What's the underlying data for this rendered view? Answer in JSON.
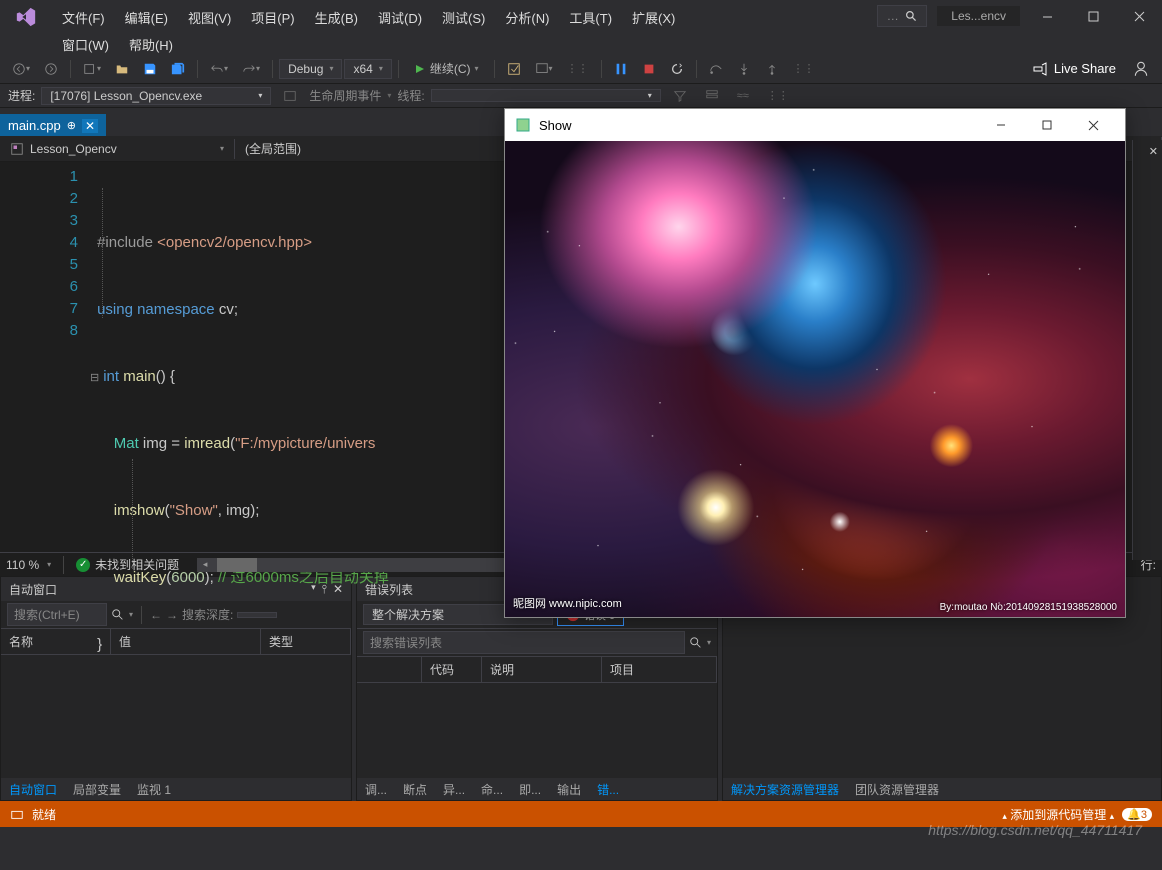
{
  "menubar": {
    "file": "文件(F)",
    "edit": "编辑(E)",
    "view": "视图(V)",
    "project": "项目(P)",
    "build": "生成(B)",
    "debug": "调试(D)",
    "test": "测试(S)",
    "analyze": "分析(N)",
    "tools": "工具(T)",
    "extensions": "扩展(X)",
    "window": "窗口(W)",
    "help": "帮助(H)"
  },
  "title_tab": "Les...encv",
  "toolbar": {
    "config": "Debug",
    "platform": "x64",
    "continue": "继续(C)",
    "live_share": "Live Share"
  },
  "debugbar": {
    "process_label": "进程:",
    "process": "[17076] Lesson_Opencv.exe",
    "lifecycle": "生命周期事件",
    "thread_label": "线程:"
  },
  "tab": {
    "name": "main.cpp"
  },
  "navbar": {
    "project": "Lesson_Opencv",
    "scope": "(全局范围)"
  },
  "code": {
    "l1": {
      "pre": "#include ",
      "inc": "<opencv2/opencv.hpp>"
    },
    "l2": {
      "kw": "using namespace ",
      "ns": "cv",
      ";": ";"
    },
    "l3": {
      "kw": "int ",
      "fn": "main",
      "rest": "() {"
    },
    "l4": {
      "cls": "Mat ",
      "id": "img ",
      "op": "= ",
      "fn": "imread",
      "p1": "(",
      "str": "\"F:/mypicture/univers",
      "rest": ""
    },
    "l5": {
      "fn": "imshow",
      "p": "(",
      "str": "\"Show\"",
      "c": ", ",
      "id": "img",
      "e": ");"
    },
    "l6": {
      "fn": "waitKey",
      "p": "(",
      "num": "6000",
      "e": "); ",
      "cm": "// 过6000ms之后自动关掉"
    },
    "l7": {
      "brace": "}"
    }
  },
  "lines": [
    "1",
    "2",
    "3",
    "4",
    "5",
    "6",
    "7",
    "8"
  ],
  "editor_footer": {
    "zoom": "110 %",
    "issues": "未找到相关问题",
    "line_label": "行:"
  },
  "auto_panel": {
    "title": "自动窗口",
    "search_ph": "搜索(Ctrl+E)",
    "depth_label": "搜索深度:",
    "cols": {
      "name": "名称",
      "value": "值",
      "type": "类型"
    }
  },
  "error_panel": {
    "title": "错误列表",
    "solution": "整个解决方案",
    "errors": "错误 0",
    "search_ph": "搜索错误列表",
    "cols": {
      "code": "代码",
      "desc": "说明",
      "project": "项目"
    }
  },
  "bottom_tabs_left": {
    "auto": "自动窗口",
    "locals": "局部变量",
    "watch": "监视 1"
  },
  "bottom_tabs_mid": {
    "a": "调...",
    "b": "断点",
    "c": "异...",
    "d": "命...",
    "e": "即...",
    "f": "输出",
    "g": "错..."
  },
  "bottom_tabs_right": {
    "a": "解决方案资源管理器",
    "b": "团队资源管理器"
  },
  "status": {
    "ready": "就绪",
    "scm": "添加到源代码管理",
    "badge": "3"
  },
  "popup": {
    "title": "Show",
    "caption": "By:moutao No:20140928151938528000",
    "logo": "昵图网 www.nipic.com"
  },
  "watermark": "https://blog.csdn.net/qq_44711417"
}
